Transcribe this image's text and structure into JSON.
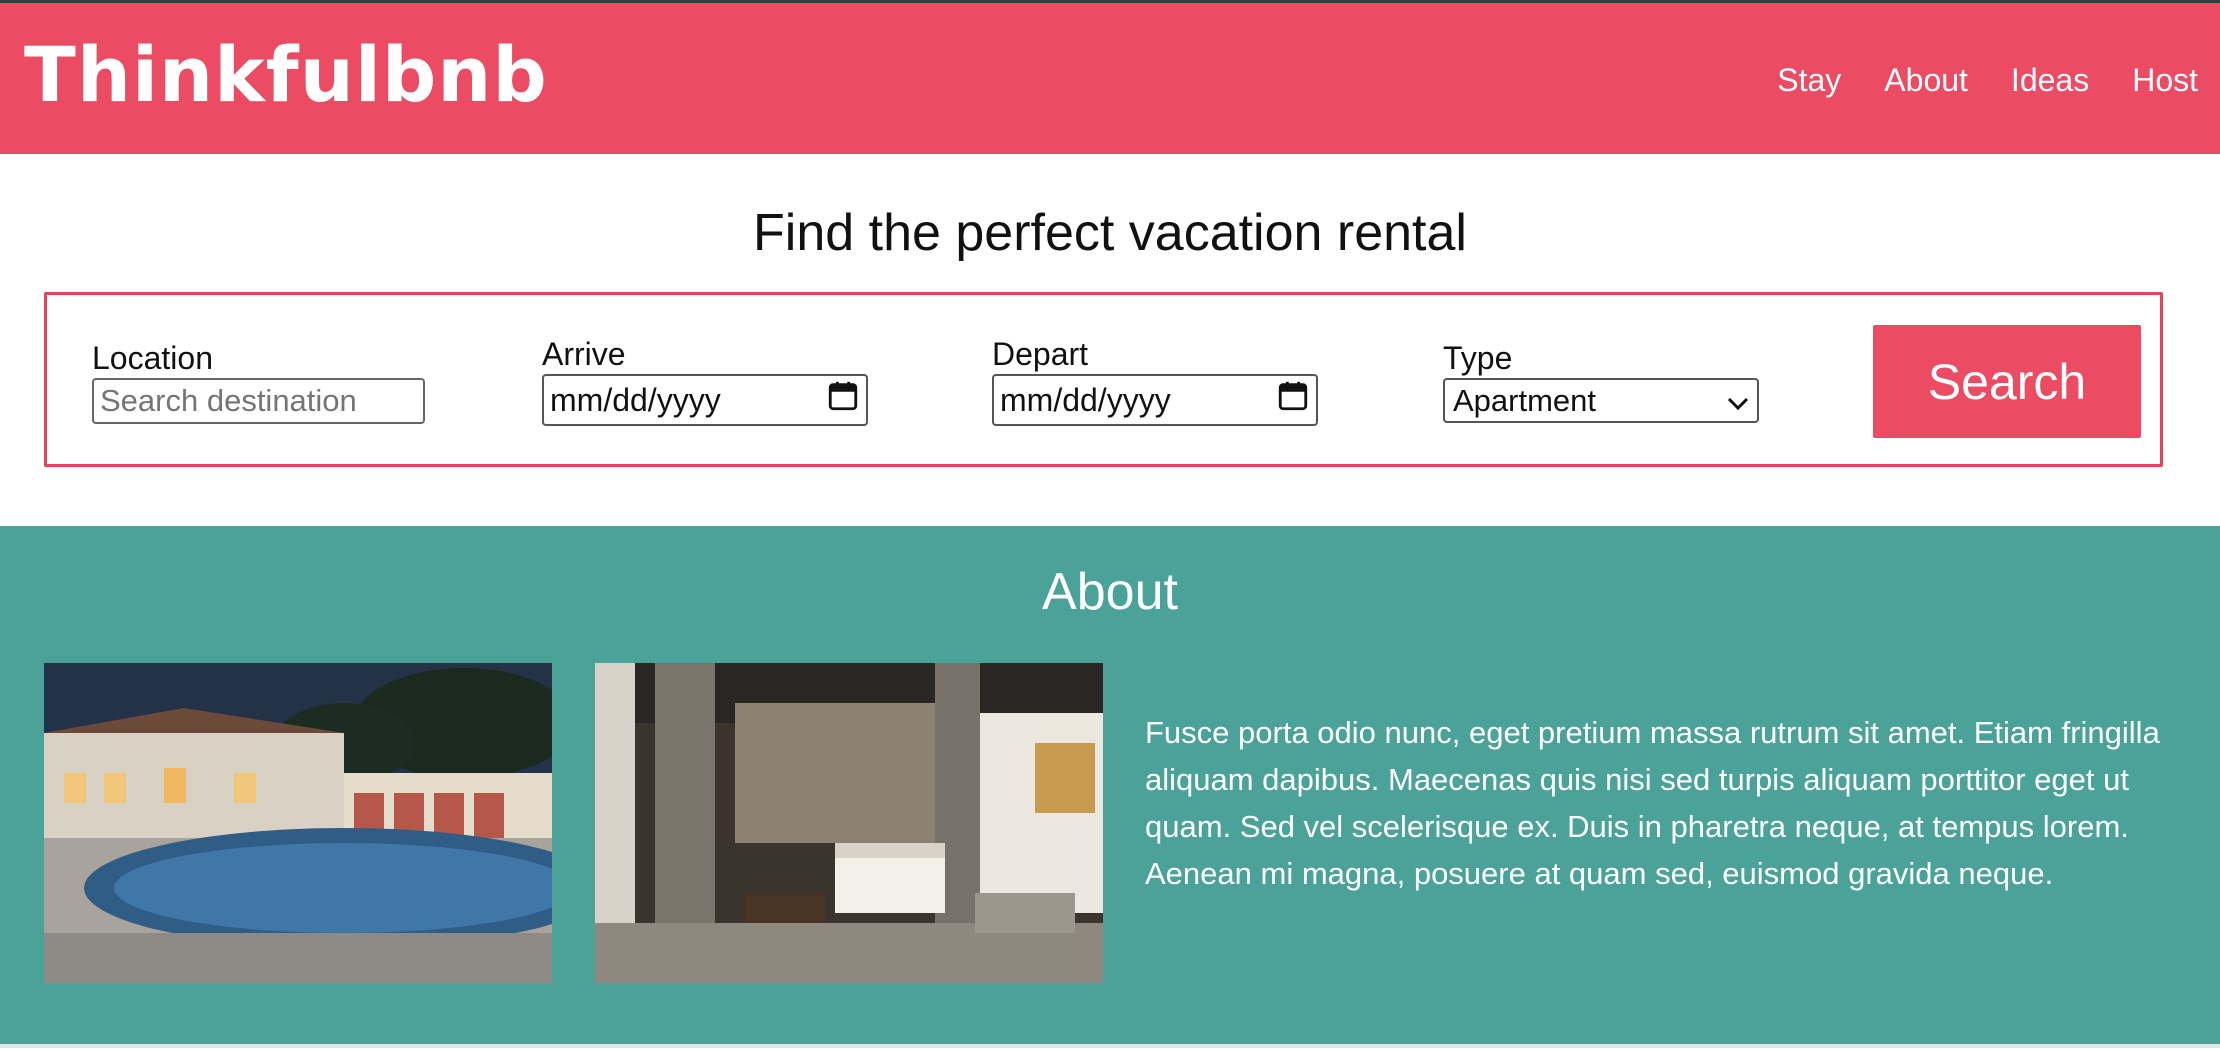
{
  "brand": {
    "logo": "Thinkfulbnb",
    "accent": "#ec4c63",
    "about_bg": "#4aa298"
  },
  "nav": {
    "items": [
      "Stay",
      "About",
      "Ideas",
      "Host"
    ]
  },
  "hero": {
    "title": "Find the perfect vacation rental",
    "form": {
      "location": {
        "label": "Location",
        "placeholder": "Search destination",
        "value": ""
      },
      "arrive": {
        "label": "Arrive",
        "value": "mm/dd/yyyy"
      },
      "depart": {
        "label": "Depart",
        "value": "mm/dd/yyyy"
      },
      "type": {
        "label": "Type",
        "selected": "Apartment"
      },
      "search_label": "Search"
    }
  },
  "about": {
    "title": "About",
    "text": "Fusce porta odio nunc, eget pretium massa rutrum sit amet. Etiam fringilla aliquam dapibus. Maecenas quis nisi sed turpis aliquam porttitor eget ut quam. Sed vel scelerisque ex. Duis in pharetra neque, at tempus lorem. Aenean mi magna, posuere at quam sed, euismod gravida neque."
  }
}
